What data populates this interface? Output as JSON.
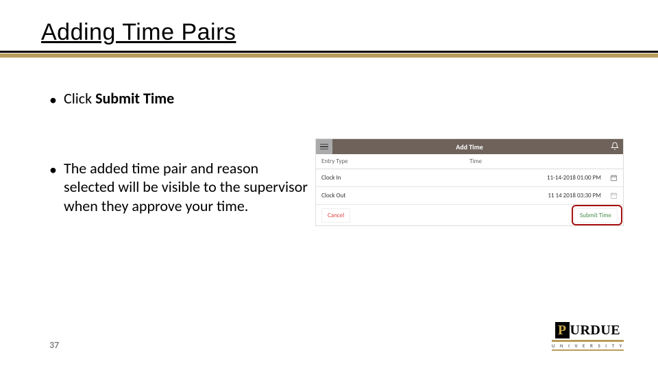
{
  "title": "Adding Time Pairs",
  "bullets": {
    "b1_prefix": "Click ",
    "b1_bold": "Submit Time",
    "b2": "The added time pair and reason selected will be visible to the supervisor when they approve your time."
  },
  "app": {
    "title": "Add Time",
    "headers": {
      "entry_type": "Entry Type",
      "time": "Time"
    },
    "rows": [
      {
        "label": "Clock In",
        "value": "11-14-2018 01:00 PM"
      },
      {
        "label": "Clock Out",
        "value": "11 14 2018 03:30 PM"
      }
    ],
    "cancel": "Cancel",
    "submit": "Submit Time"
  },
  "logo": {
    "p": "P",
    "rest": "URDUE",
    "sub": "U N I V E R S I T Y"
  },
  "page_number": "37"
}
